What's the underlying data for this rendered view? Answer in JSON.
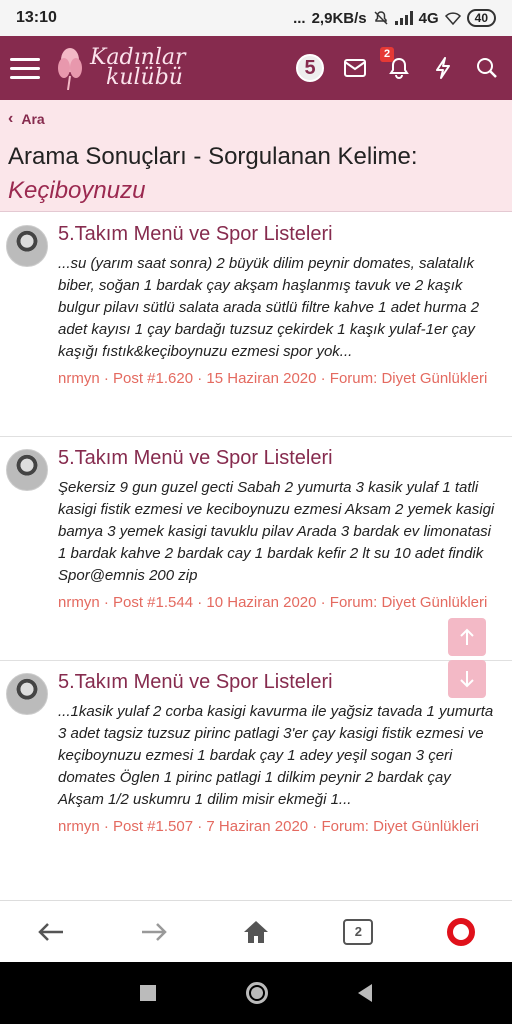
{
  "statusbar": {
    "time": "13:10",
    "dots": "...",
    "speed": "2,9KB/s",
    "network": "4G",
    "battery": "40"
  },
  "appbar": {
    "logo_line1": "Kadınlar",
    "logo_line2": "kulübü",
    "five_label": "5",
    "notification_count": "2"
  },
  "breadcrumb": {
    "label": "Ara"
  },
  "page": {
    "title": "Arama Sonuçları - Sorgulanan Kelime:",
    "keyword": "Keçiboynuzu"
  },
  "results": [
    {
      "title": "5.Takım Menü ve Spor Listeleri",
      "snippet": "...su (yarım saat sonra) 2 büyük dilim peynir domates, salatalık biber, soğan 1 bardak çay akşam haşlanmış tavuk ve 2 kaşık bulgur pilavı sütlü salata arada sütlü filtre kahve 1 adet hurma 2 adet kayısı 1 çay bardağı tuzsuz çekirdek 1 kaşık yulaf-1er çay kaşığı fıstık&keçiboynuzu ezmesi spor yok...",
      "meta": "nrmyn · Post #1.620 · 15 Haziran 2020 · Forum: Diyet Günlükleri"
    },
    {
      "title": "5.Takım Menü ve Spor Listeleri",
      "snippet": "Şekersiz 9 gun guzel gecti Sabah 2 yumurta 3 kasik yulaf 1 tatli kasigi fistik ezmesi ve keciboynuzu ezmesi Aksam 2 yemek kasigi bamya 3 yemek kasigi tavuklu pilav Arada 3 bardak ev limonatasi 1 bardak kahve 2 bardak cay 1 bardak kefir 2 lt su 10 adet findik Spor@emnis 200 zip",
      "meta": "nrmyn · Post #1.544 · 10 Haziran 2020 · Forum: Diyet Günlükleri"
    },
    {
      "title": "5.Takım Menü ve Spor Listeleri",
      "snippet": "...1kasik yulaf 2 corba kasigi kavurma ile yağsiz tavada 1 yumurta 3 adet tagsiz tuzsuz pirinc patlagi 3'er çay kasigi fistik ezmesi ve keçiboynuzu ezmesi 1 bardak çay 1 adey yeşil sogan 3 çeri domates Öglen 1 pirinc patlagi 1 dilkim peynir 2 bardak çay Akşam 1/2 uskumru 1 dilim misir ekmeği 1...",
      "meta": "nrmyn · Post #1.507 · 7 Haziran 2020 · Forum: Diyet Günlükleri"
    }
  ],
  "bottomnav": {
    "tabs_count": "2"
  },
  "icons": {
    "menu": "hamburger-icon",
    "mail": "mail-icon",
    "bell": "bell-icon",
    "bolt": "bolt-icon",
    "search": "search-icon",
    "back": "arrow-left-icon",
    "forward": "arrow-right-icon",
    "home": "home-icon",
    "tabs": "tabs-icon",
    "opera": "opera-icon"
  },
  "colors": {
    "brand": "#862b4e",
    "header_bg": "#fbe6ea",
    "meta": "#e46a60",
    "scroll_button": "#f3b9c6"
  }
}
